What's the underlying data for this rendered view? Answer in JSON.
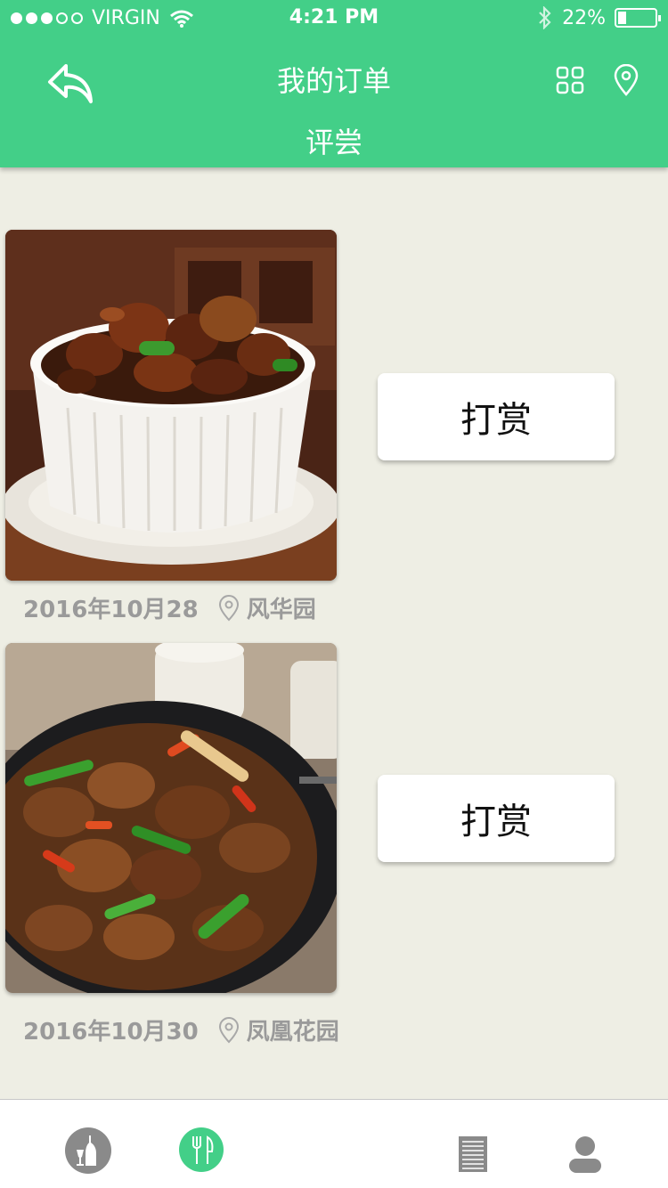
{
  "status_bar": {
    "carrier": "VIRGIN",
    "time": "4:21 PM",
    "battery_text": "22%",
    "battery_level": 0.22
  },
  "header": {
    "title": "我的订单",
    "subtitle": "评尝"
  },
  "orders": [
    {
      "tip_label": "打赏",
      "date": "2016年10月28",
      "location": "风华园",
      "image": "braised-pork-in-white-bowl"
    },
    {
      "tip_label": "打赏",
      "date": "2016年10月30",
      "location": "凤凰花园",
      "image": "spicy-chicken-in-pan"
    }
  ],
  "tabbar": {
    "items": [
      {
        "icon": "drink-icon",
        "active": false
      },
      {
        "icon": "dining-icon",
        "active": true
      },
      {
        "icon": "list-icon",
        "active": false
      },
      {
        "icon": "user-icon",
        "active": false
      }
    ]
  },
  "colors": {
    "brand": "#43cf88",
    "background": "#eeeee4",
    "muted_text": "#9a9a9a"
  }
}
